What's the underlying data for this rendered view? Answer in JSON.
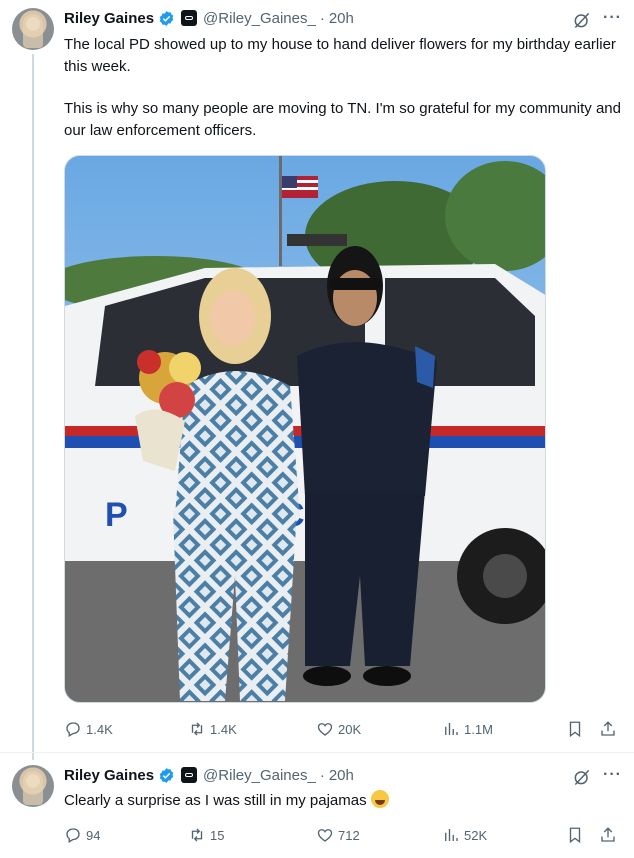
{
  "tweets": [
    {
      "author": {
        "name": "Riley Gaines",
        "handle": "@Riley_Gaines_",
        "time": "20h"
      },
      "text_p1": "The local PD showed up to my house to hand deliver flowers for my birthday earlier this week.",
      "text_p2": "This is why so many people are moving to TN. I'm so grateful for my community and our law enforcement officers.",
      "media": "photo",
      "stats": {
        "replies": "1.4K",
        "reposts": "1.4K",
        "likes": "20K",
        "views": "1.1M"
      }
    },
    {
      "author": {
        "name": "Riley Gaines",
        "handle": "@Riley_Gaines_",
        "time": "20h"
      },
      "text": "Clearly a surprise as I was still in my pajamas",
      "emoji": "face-with-tears-of-joy",
      "stats": {
        "replies": "94",
        "reposts": "15",
        "likes": "712",
        "views": "52K"
      }
    }
  ],
  "colors": {
    "verified": "#1d9bf0",
    "muted": "#536471",
    "text": "#0f1419",
    "thread_line": "#cfd9de"
  },
  "icons": [
    "verified-badge-icon",
    "affiliate-badge-icon",
    "grok-icon",
    "more-icon",
    "reply-icon",
    "repost-icon",
    "like-icon",
    "views-icon",
    "bookmark-icon",
    "share-icon"
  ]
}
